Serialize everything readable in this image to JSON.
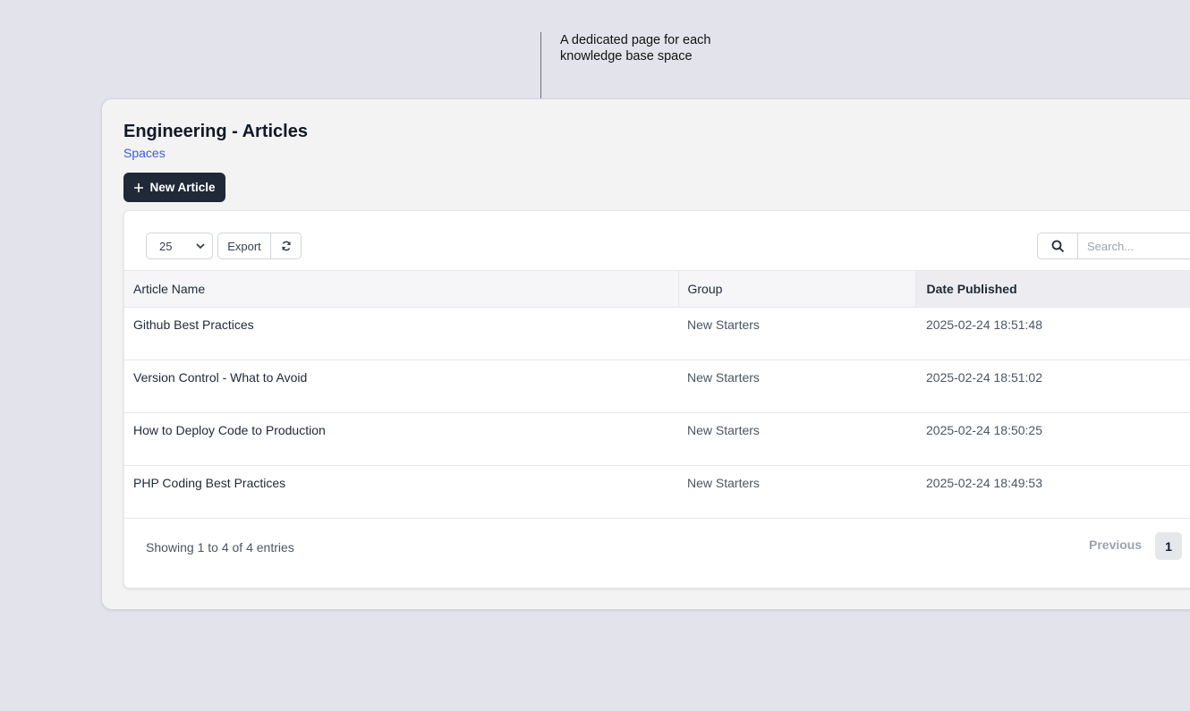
{
  "annotation": {
    "line1": "A dedicated page for each",
    "line2": "knowledge base space"
  },
  "header": {
    "title": "Engineering - Articles",
    "breadcrumb": "Spaces",
    "new_button": "New Article"
  },
  "toolbar": {
    "page_size": "25",
    "export_label": "Export",
    "search_placeholder": "Search..."
  },
  "table": {
    "columns": [
      "Article Name",
      "Group",
      "Date Published"
    ],
    "sorted_column": "Date Published",
    "rows": [
      {
        "name": "Github Best Practices",
        "group": "New Starters",
        "date": "2025-02-24 18:51:48"
      },
      {
        "name": "Version Control - What to Avoid",
        "group": "New Starters",
        "date": "2025-02-24 18:51:02"
      },
      {
        "name": "How to Deploy Code to Production",
        "group": "New Starters",
        "date": "2025-02-24 18:50:25"
      },
      {
        "name": "PHP Coding Best Practices",
        "group": "New Starters",
        "date": "2025-02-24 18:49:53"
      }
    ]
  },
  "footer": {
    "info": "Showing 1 to 4 of 4 entries",
    "previous": "Previous",
    "current_page": "1"
  }
}
